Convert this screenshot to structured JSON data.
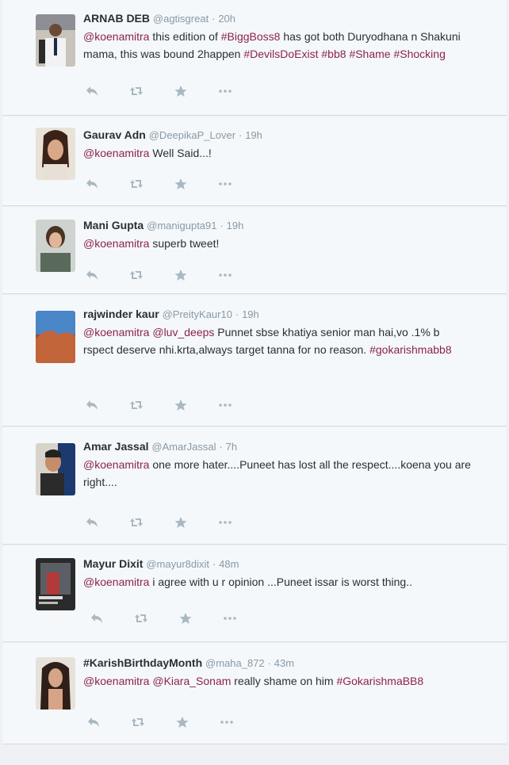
{
  "tweets": [
    {
      "name": "ARNAB DEB",
      "handle": "@agtisgreat",
      "time": "20h",
      "segments": [
        {
          "t": "mention",
          "v": "@koenamitra"
        },
        {
          "t": "text",
          "v": " this edition of "
        },
        {
          "t": "hashtag",
          "v": "#BiggBoss8"
        },
        {
          "t": "text",
          "v": " has got both Duryodhana n Shakuni mama, this was bound 2happen "
        },
        {
          "t": "hashtag",
          "v": "#DevilsDoExist"
        },
        {
          "t": "text",
          "v": " "
        },
        {
          "t": "hashtag",
          "v": "#bb8"
        },
        {
          "t": "text",
          "v": " "
        },
        {
          "t": "hashtag",
          "v": "#Shame"
        },
        {
          "t": "text",
          "v": " "
        },
        {
          "t": "hashtag",
          "v": "#Shocking"
        }
      ]
    },
    {
      "name": "Gaurav Adn",
      "handle": "@DeepikaP_Lover",
      "time": "19h",
      "segments": [
        {
          "t": "mention",
          "v": "@koenamitra"
        },
        {
          "t": "text",
          "v": " Well Said...!"
        }
      ]
    },
    {
      "name": "Mani Gupta",
      "handle": "@manigupta91",
      "time": "19h",
      "segments": [
        {
          "t": "mention",
          "v": "@koenamitra"
        },
        {
          "t": "text",
          "v": " superb tweet!"
        }
      ]
    },
    {
      "name": "rajwinder kaur",
      "handle": "@PreityKaur10",
      "time": "19h",
      "segments": [
        {
          "t": "mention",
          "v": "@koenamitra"
        },
        {
          "t": "text",
          "v": " "
        },
        {
          "t": "mention",
          "v": "@luv_deeps"
        },
        {
          "t": "text",
          "v": " Punnet sbse khatiya senior man hai,vo .1% b rspect deserve nhi.krta,always target tanna for no reason. "
        },
        {
          "t": "hashtag",
          "v": "#gokarishmabb8"
        }
      ]
    },
    {
      "name": "Amar Jassal",
      "handle": "@AmarJassal",
      "time": "7h",
      "segments": [
        {
          "t": "mention",
          "v": "@koenamitra"
        },
        {
          "t": "text",
          "v": " one more hater....Puneet has lost all the respect....koena you are right...."
        }
      ]
    },
    {
      "name": "Mayur Dixit",
      "handle": "@mayur8dixit",
      "time": "48m",
      "segments": [
        {
          "t": "mention",
          "v": "@koenamitra"
        },
        {
          "t": "text",
          "v": "  i agree with u r opinion ...Puneet issar is worst thing.."
        }
      ]
    },
    {
      "name": "#KarishBirthdayMonth",
      "handle": "@maha_872",
      "time": "43m",
      "segments": [
        {
          "t": "mention",
          "v": "@koenamitra"
        },
        {
          "t": "text",
          "v": " "
        },
        {
          "t": "mention",
          "v": "@Kiara_Sonam"
        },
        {
          "t": "text",
          "v": " really shame on him "
        },
        {
          "t": "hashtag",
          "v": "#GokarishmaBB8"
        }
      ]
    }
  ],
  "icons": [
    "reply-icon",
    "retweet-icon",
    "favorite-icon",
    "more-icon"
  ],
  "colors": {
    "link": "#8b2252",
    "meta": "#8899a6",
    "icon": "#aab8c2"
  }
}
